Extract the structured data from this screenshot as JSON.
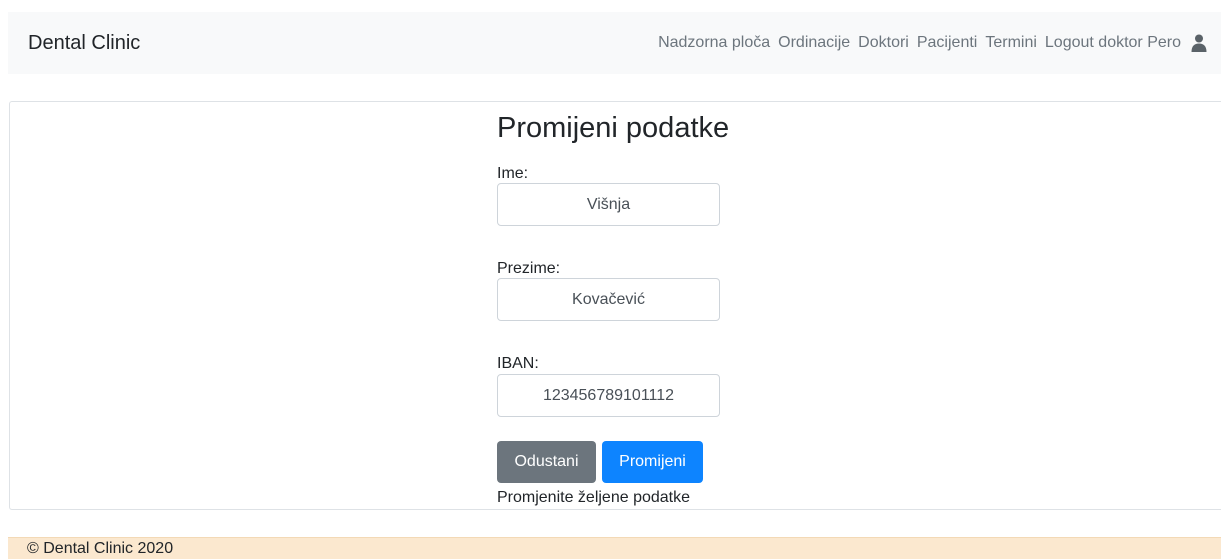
{
  "navbar": {
    "brand": "Dental Clinic",
    "links": [
      "Nadzorna ploča",
      "Ordinacije",
      "Doktori",
      "Pacijenti",
      "Termini",
      "Logout doktor Pero"
    ],
    "user_icon": "user-icon"
  },
  "form": {
    "title": "Promijeni podatke",
    "fields": [
      {
        "label": "Ime:",
        "value": "Višnja"
      },
      {
        "label": "Prezime:",
        "value": "Kovačević"
      },
      {
        "label": "IBAN:",
        "value": "123456789101112"
      }
    ],
    "cancel_label": "Odustani",
    "submit_label": "Promijeni",
    "hint": "Promjenite željene podatke"
  },
  "footer": {
    "text": "© Dental Clinic 2020"
  },
  "colors": {
    "navbar_bg": "#f8f9fa",
    "primary": "#0d84ff",
    "secondary": "#6c757d",
    "footer_bg": "#fbe8cf"
  }
}
